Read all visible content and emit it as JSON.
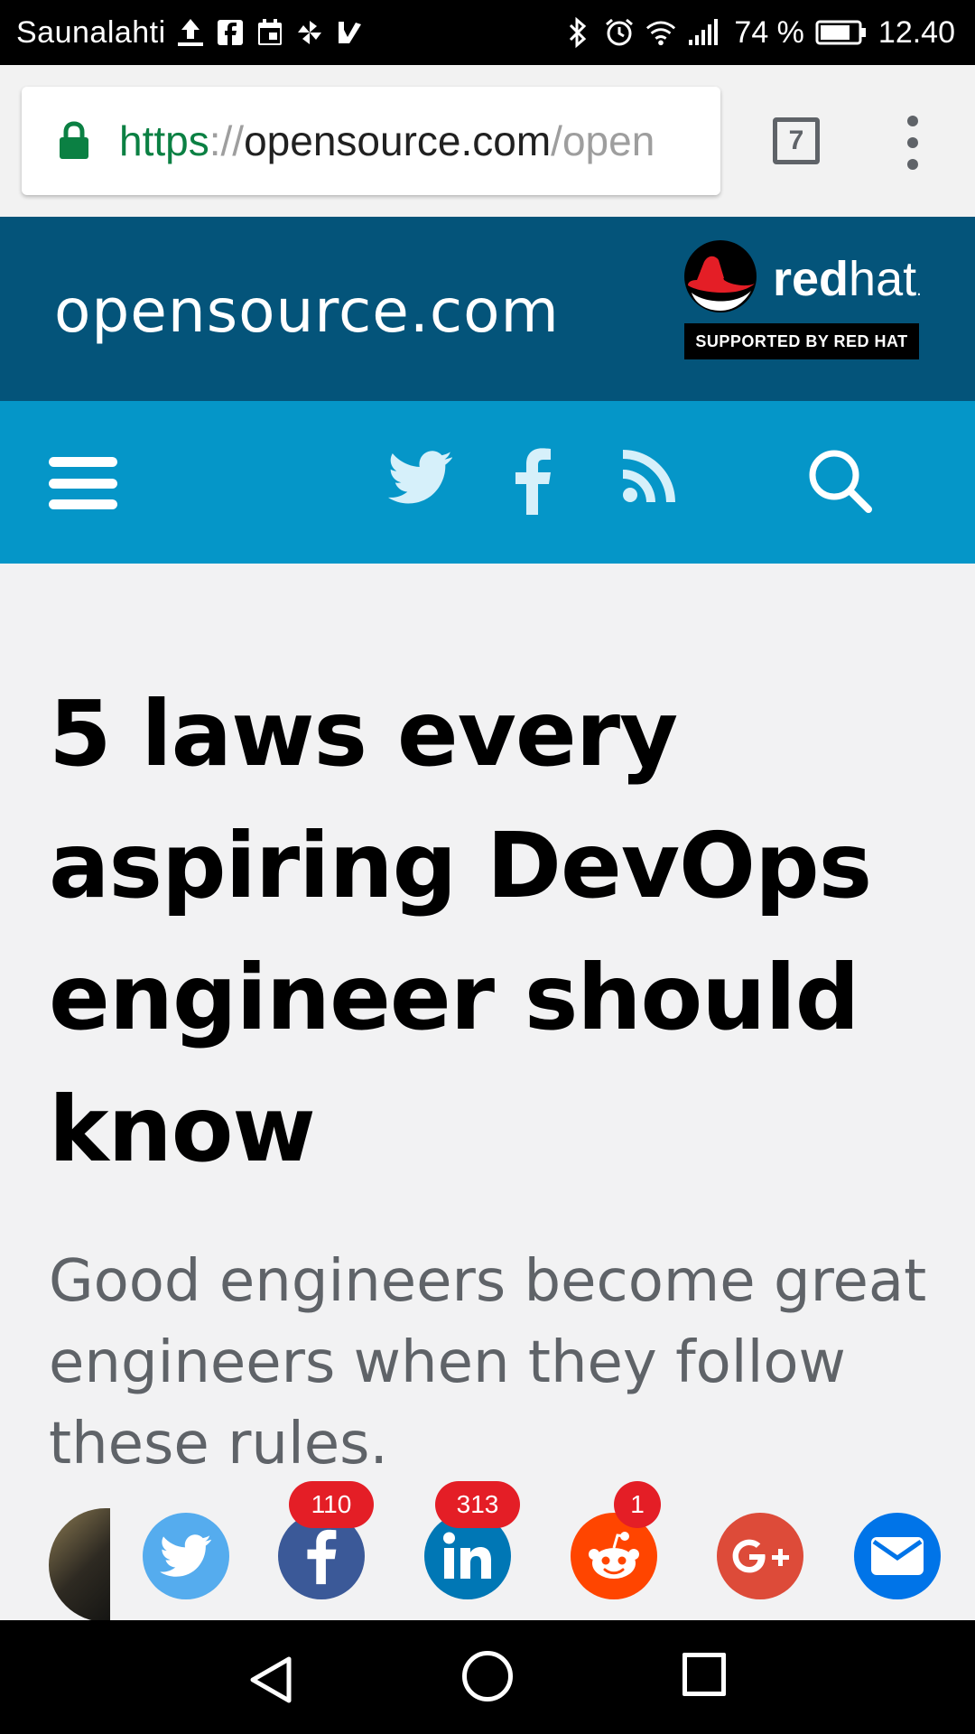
{
  "status_bar": {
    "carrier": "Saunalahti",
    "battery_percent": "74 %",
    "time": "12.40",
    "left_icons": [
      "upload-icon",
      "facebook-notification-icon",
      "calendar-icon",
      "pinwheel-icon",
      "checkmark-notification-icon"
    ],
    "right_icons": [
      "bluetooth-icon",
      "alarm-icon",
      "wifi-icon",
      "signal-icon",
      "battery-icon"
    ]
  },
  "browser": {
    "url_scheme": "https",
    "url_separator": "://",
    "url_host": "opensource.com",
    "url_path": "/open",
    "tab_count": "7",
    "lock_color": "#0b8043"
  },
  "site_header": {
    "site_name": "opensource.com",
    "sponsor_word_bold": "red",
    "sponsor_word_light": "hat",
    "sponsor_tm": ".",
    "sponsor_badge": "SUPPORTED BY RED HAT",
    "background_color": "#04547a"
  },
  "nav": {
    "background_color": "#0596c8",
    "icons": [
      "menu-icon",
      "twitter-icon",
      "facebook-icon",
      "rss-icon",
      "search-icon"
    ]
  },
  "article": {
    "title": "5 laws every aspiring DevOps engineer should know",
    "subtitle": "Good engineers become great engineers when they follow these rules."
  },
  "share": {
    "buttons": [
      {
        "network": "twitter",
        "color": "#55acee",
        "count": null
      },
      {
        "network": "facebook",
        "color": "#3b5998",
        "count": "110"
      },
      {
        "network": "linkedin",
        "color": "#0077b5",
        "count": "313"
      },
      {
        "network": "reddit",
        "color": "#ff4500",
        "count": "1"
      },
      {
        "network": "google-plus",
        "color": "#dd4b39",
        "count": null
      },
      {
        "network": "email",
        "color": "#0074e8",
        "count": null
      }
    ]
  },
  "android_nav": {
    "buttons": [
      "back-icon",
      "home-icon",
      "recents-icon"
    ]
  }
}
